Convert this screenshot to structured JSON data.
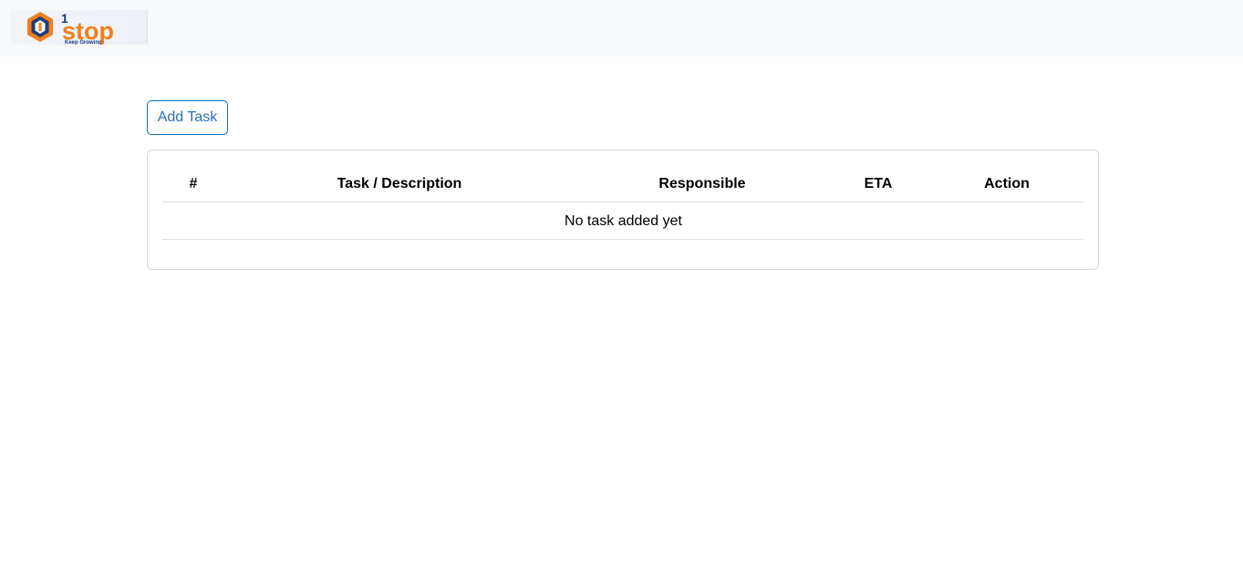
{
  "header": {
    "logo": {
      "brand_number": "1",
      "brand_word": "stop",
      "tagline": "Keep Growing",
      "colors": {
        "orange": "#f07f1b",
        "navy": "#1d3a7a"
      }
    }
  },
  "toolbar": {
    "add_task_label": "Add Task"
  },
  "task_table": {
    "columns": [
      "#",
      "Task / Description",
      "Responsible",
      "ETA",
      "Action"
    ],
    "empty_message": "No task added yet",
    "rows": []
  },
  "colors": {
    "accent": "#0d6ebd",
    "navbar_bg": "#f8f9fb",
    "border": "#dee2e6"
  }
}
